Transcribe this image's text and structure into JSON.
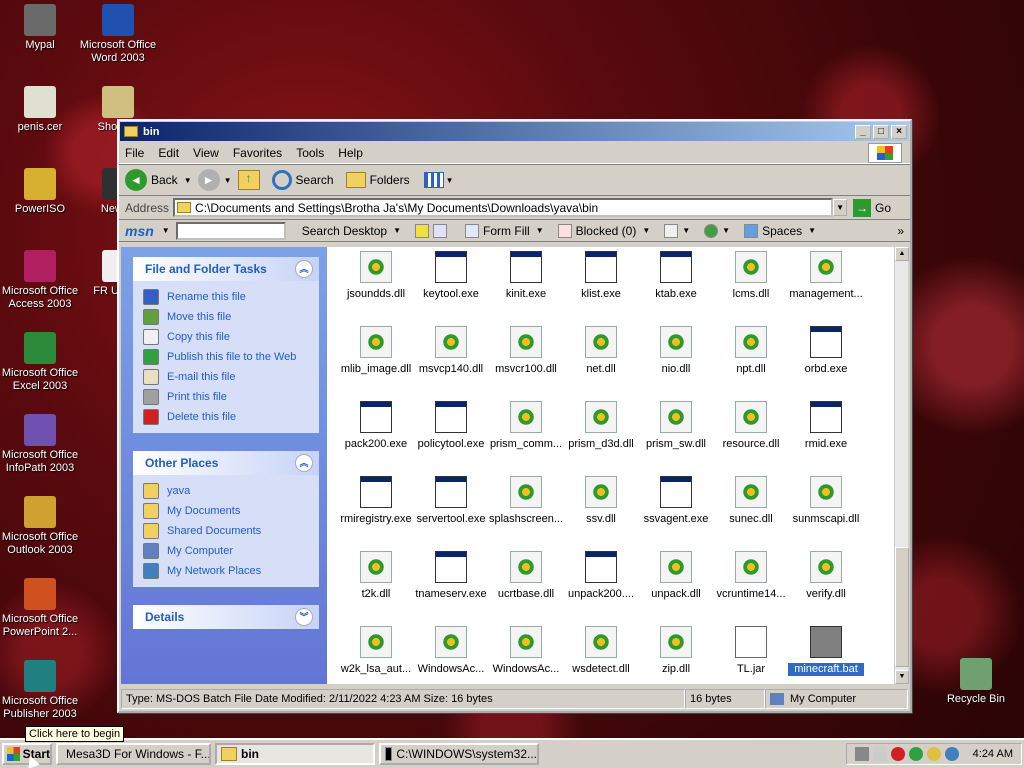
{
  "desktop": {
    "icons": [
      {
        "label": "Mypal",
        "color": "#6a6a6a"
      },
      {
        "label": "Microsoft Office Word 2003",
        "color": "#2050b0"
      },
      {
        "label": "penis.cer",
        "color": "#e0e0d0"
      },
      {
        "label": "Short To",
        "color": "#d0c080"
      },
      {
        "label": "PowerISO",
        "color": "#d8b030"
      },
      {
        "label": "New M",
        "color": "#303030"
      },
      {
        "label": "Microsoft Office Access 2003",
        "color": "#b02060"
      },
      {
        "label": "FR UPGR",
        "color": "#f0f0f0"
      },
      {
        "label": "Microsoft Office Excel 2003",
        "color": "#2a8a3a"
      },
      {
        "label": "Microsoft Office InfoPath 2003",
        "color": "#7050b0"
      },
      {
        "label": "Microsoft Office Outlook 2003",
        "color": "#d0a030"
      },
      {
        "label": "Microsoft Office PowerPoint 2...",
        "color": "#d05020"
      },
      {
        "label": "Microsoft Office Publisher 2003",
        "color": "#208080"
      },
      {
        "label": "Recycle Bin",
        "color": "#70a070"
      }
    ]
  },
  "window": {
    "title": "bin",
    "menu": [
      "File",
      "Edit",
      "View",
      "Favorites",
      "Tools",
      "Help"
    ],
    "toolbar": {
      "back": "Back",
      "search": "Search",
      "folders": "Folders"
    },
    "address": {
      "label": "Address",
      "value": "C:\\Documents and Settings\\Brotha Ja's\\My Documents\\Downloads\\yava\\bin",
      "go": "Go"
    },
    "msn": {
      "logo": "msn",
      "search_desktop": "Search Desktop",
      "form_fill": "Form Fill",
      "blocked": "Blocked (0)",
      "spaces": "Spaces"
    },
    "tasks_panel": {
      "title": "File and Folder Tasks",
      "items": [
        {
          "label": "Rename this file",
          "icon": "rename-icon",
          "color": "#3060c0"
        },
        {
          "label": "Move this file",
          "icon": "move-icon",
          "color": "#60a040"
        },
        {
          "label": "Copy this file",
          "icon": "copy-icon",
          "color": "#f0f0f0"
        },
        {
          "label": "Publish this file to the Web",
          "icon": "globe-icon",
          "color": "#30a040"
        },
        {
          "label": "E-mail this file",
          "icon": "mail-icon",
          "color": "#e8e0c0"
        },
        {
          "label": "Print this file",
          "icon": "printer-icon",
          "color": "#a0a0a0"
        },
        {
          "label": "Delete this file",
          "icon": "delete-icon",
          "color": "#d02020"
        }
      ]
    },
    "places_panel": {
      "title": "Other Places",
      "items": [
        {
          "label": "yava",
          "icon": "folder-icon",
          "color": "#f0d060"
        },
        {
          "label": "My Documents",
          "icon": "folder-icon",
          "color": "#f0d060"
        },
        {
          "label": "Shared Documents",
          "icon": "folder-icon",
          "color": "#f0d060"
        },
        {
          "label": "My Computer",
          "icon": "computer-icon",
          "color": "#6080c0"
        },
        {
          "label": "My Network Places",
          "icon": "network-icon",
          "color": "#4080c0"
        }
      ]
    },
    "details_panel": {
      "title": "Details"
    },
    "files": [
      {
        "name": "jsoundds.dll",
        "type": "dll"
      },
      {
        "name": "keytool.exe",
        "type": "exe"
      },
      {
        "name": "kinit.exe",
        "type": "exe"
      },
      {
        "name": "klist.exe",
        "type": "exe"
      },
      {
        "name": "ktab.exe",
        "type": "exe"
      },
      {
        "name": "lcms.dll",
        "type": "dll"
      },
      {
        "name": "management...",
        "type": "dll"
      },
      {
        "name": "mlib_image.dll",
        "type": "dll"
      },
      {
        "name": "msvcp140.dll",
        "type": "dll"
      },
      {
        "name": "msvcr100.dll",
        "type": "dll"
      },
      {
        "name": "net.dll",
        "type": "dll"
      },
      {
        "name": "nio.dll",
        "type": "dll"
      },
      {
        "name": "npt.dll",
        "type": "dll"
      },
      {
        "name": "orbd.exe",
        "type": "exe"
      },
      {
        "name": "pack200.exe",
        "type": "exe"
      },
      {
        "name": "policytool.exe",
        "type": "exe"
      },
      {
        "name": "prism_comm...",
        "type": "dll"
      },
      {
        "name": "prism_d3d.dll",
        "type": "dll"
      },
      {
        "name": "prism_sw.dll",
        "type": "dll"
      },
      {
        "name": "resource.dll",
        "type": "dll"
      },
      {
        "name": "rmid.exe",
        "type": "exe"
      },
      {
        "name": "rmiregistry.exe",
        "type": "exe"
      },
      {
        "name": "servertool.exe",
        "type": "exe"
      },
      {
        "name": "splashscreen...",
        "type": "dll"
      },
      {
        "name": "ssv.dll",
        "type": "dll"
      },
      {
        "name": "ssvagent.exe",
        "type": "exe"
      },
      {
        "name": "sunec.dll",
        "type": "dll"
      },
      {
        "name": "sunmscapi.dll",
        "type": "dll"
      },
      {
        "name": "t2k.dll",
        "type": "dll"
      },
      {
        "name": "tnameserv.exe",
        "type": "exe"
      },
      {
        "name": "ucrtbase.dll",
        "type": "dll"
      },
      {
        "name": "unpack200....",
        "type": "exe"
      },
      {
        "name": "unpack.dll",
        "type": "dll"
      },
      {
        "name": "vcruntime14...",
        "type": "dll"
      },
      {
        "name": "verify.dll",
        "type": "dll"
      },
      {
        "name": "w2k_lsa_aut...",
        "type": "dll"
      },
      {
        "name": "WindowsAc...",
        "type": "dll"
      },
      {
        "name": "WindowsAc...",
        "type": "dll"
      },
      {
        "name": "wsdetect.dll",
        "type": "dll"
      },
      {
        "name": "zip.dll",
        "type": "dll"
      },
      {
        "name": "TL.jar",
        "type": "jar"
      },
      {
        "name": "minecraft.bat",
        "type": "bat",
        "selected": true
      }
    ],
    "status": {
      "info": "Type: MS-DOS Batch File Date Modified: 2/11/2022 4:23 AM Size: 16 bytes",
      "size": "16 bytes",
      "zone": "My Computer"
    }
  },
  "taskbar": {
    "start": "Start",
    "tooltip": "Click here to begin",
    "tasks": [
      {
        "label": "Mesa3D For Windows - F...",
        "active": false
      },
      {
        "label": "bin",
        "active": true
      },
      {
        "label": "C:\\WINDOWS\\system32...",
        "active": false
      }
    ],
    "clock": "4:24 AM"
  }
}
